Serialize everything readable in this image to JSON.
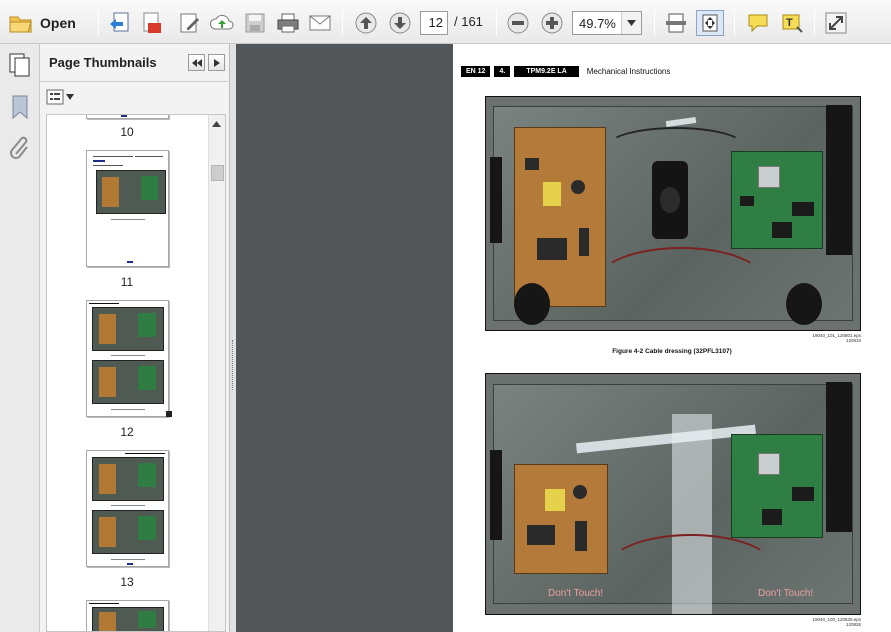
{
  "toolbar": {
    "open_label": "Open",
    "current_page": "12",
    "total_pages": "/ 161",
    "zoom_value": "49.7%",
    "icons": [
      "open-folder-icon",
      "save-pages-icon",
      "create-pdf-icon",
      "edit-pdf-icon",
      "cloud-upload-icon",
      "save-icon",
      "print-icon",
      "email-icon",
      "page-up-icon",
      "page-down-icon",
      "zoom-out-icon",
      "zoom-in-icon",
      "fit-page-icon",
      "fit-width-icon",
      "comment-icon",
      "highlight-text-icon",
      "expand-icon"
    ]
  },
  "panel": {
    "title": "Page Thumbnails",
    "thumbnails": [
      {
        "label": "10"
      },
      {
        "label": "11"
      },
      {
        "label": "12"
      },
      {
        "label": "13"
      }
    ]
  },
  "document": {
    "header": {
      "page_tag": "EN 12",
      "section_tag": "4.",
      "model_tag": "TPM9.2E LA",
      "section_title": "Mechanical Instructions"
    },
    "figure1": {
      "file_ref": "19040_101_120801.eps",
      "date_ref": "120810",
      "caption": "Figure 4-2 Cable dressing (32PFL3107)"
    },
    "figure2": {
      "file_ref": "19040_100_120830.eps",
      "date_ref": "120826",
      "warning_left": "Don't Touch!",
      "warning_right": "Don't Touch!"
    }
  },
  "colors": {
    "toolbar_bg": "#ececec",
    "doc_bg": "#525659",
    "power_board": "#b37a3a",
    "main_board": "#2f7f44"
  }
}
